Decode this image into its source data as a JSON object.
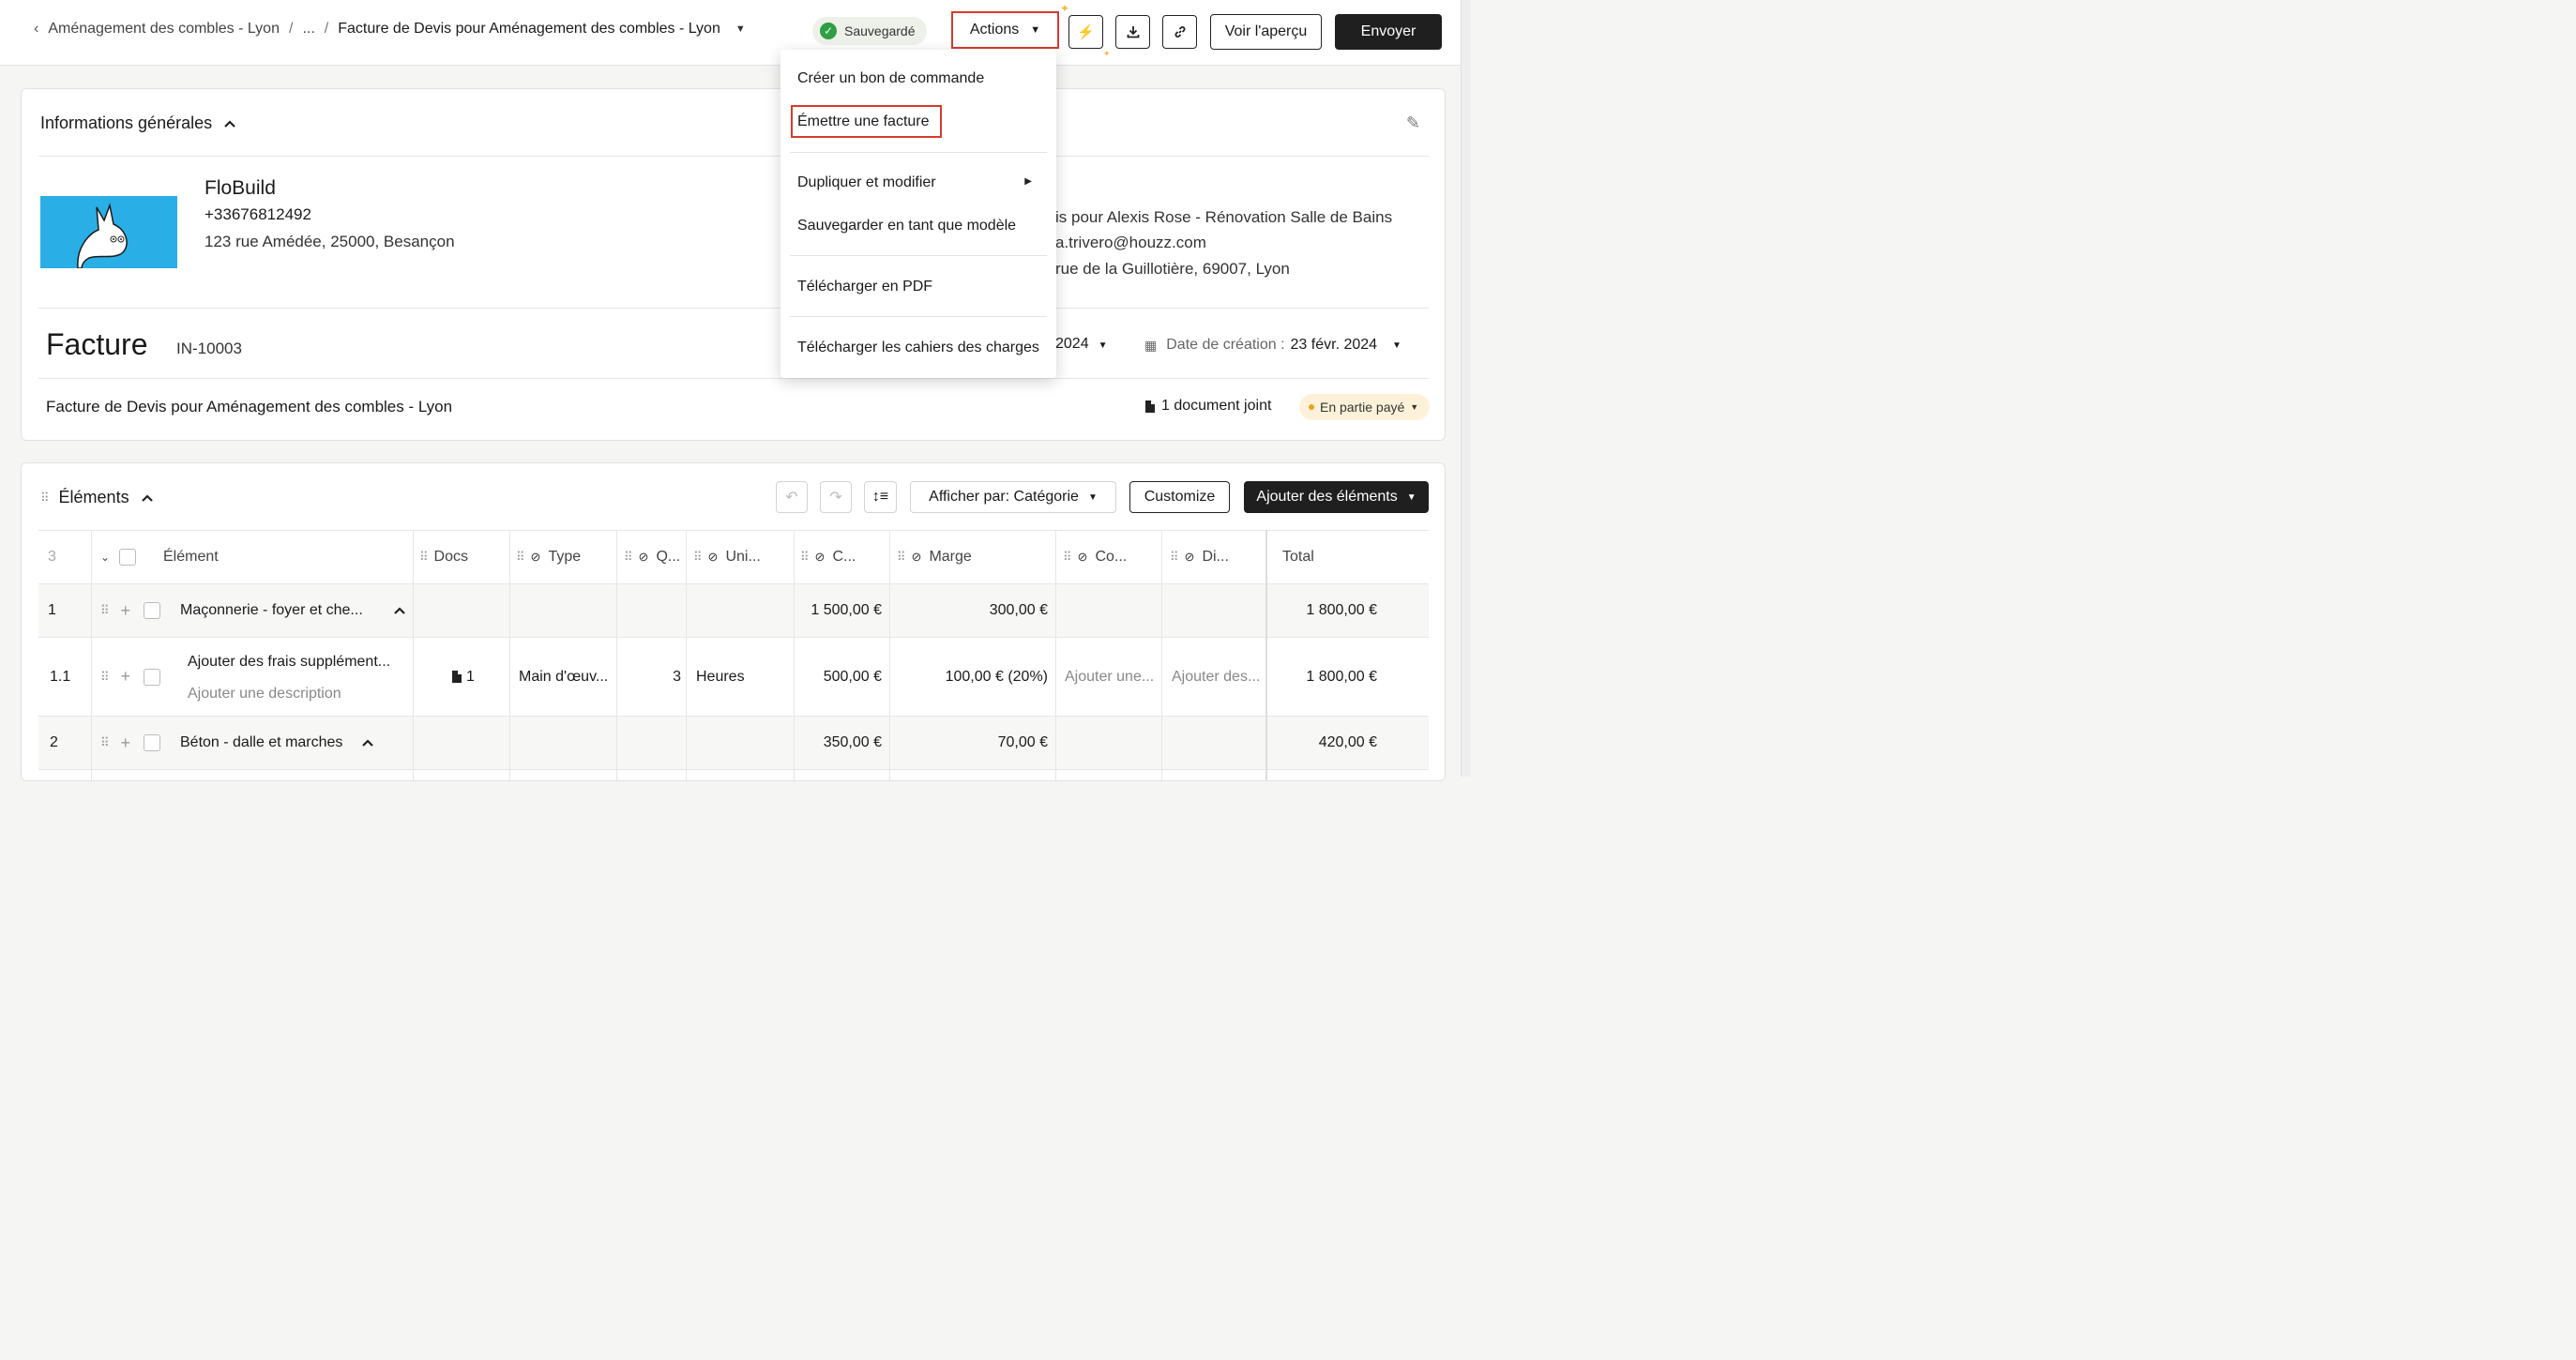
{
  "breadcrumb": {
    "parent": "Aménagement des combles - Lyon",
    "ellipsis": "...",
    "current": "Facture de Devis pour Aménagement des combles - Lyon"
  },
  "header": {
    "saved_label": "Sauvegardé",
    "actions_label": "Actions",
    "preview_label": "Voir l'aperçu",
    "send_label": "Envoyer"
  },
  "actions_menu": {
    "items": [
      "Créer un bon de commande",
      "Émettre une facture",
      "Dupliquer et modifier",
      "Sauvegarder en tant que modèle",
      "Télécharger en PDF",
      "Télécharger les cahiers des charges"
    ]
  },
  "general": {
    "title": "Informations générales",
    "company": {
      "name": "FloBuild",
      "phone": "+33676812492",
      "address": "123 rue Amédée, 25000, Besançon"
    },
    "client": {
      "line1": "is pour Alexis Rose - Rénovation Salle de Bains",
      "line2": "a.trivero@houzz.com",
      "line3": "rue de la Guillotière, 69007, Lyon"
    },
    "doc_type": "Facture",
    "doc_number": "IN-10003",
    "due_date_partial": "2024",
    "created_label": "Date de création :",
    "created_value": "23 févr. 2024",
    "description": "Facture de Devis pour Aménagement des combles - Lyon",
    "attachments": "1 document joint",
    "status": "En partie payé"
  },
  "elements": {
    "title": "Éléments",
    "view_by": "Afficher par: Catégorie",
    "customize": "Customize",
    "add_label": "Ajouter des éléments",
    "row_count": "3",
    "columns": {
      "element": "Élément",
      "docs": "Docs",
      "type": "Type",
      "qty": "Q...",
      "unit": "Uni...",
      "cost": "C...",
      "margin": "Marge",
      "co": "Co...",
      "di": "Di...",
      "total": "Total"
    },
    "rows": [
      {
        "num": "1",
        "name": "Maçonnerie - foyer et che...",
        "cost": "1 500,00 €",
        "margin": "300,00 €",
        "total": "1 800,00 €"
      },
      {
        "num": "1.1",
        "name": "Ajouter des frais supplément...",
        "desc": "Ajouter une description",
        "docs": "1",
        "type": "Main d'œuv...",
        "qty": "3",
        "unit": "Heures",
        "cost": "500,00 €",
        "margin": "100,00 € (20%)",
        "co": "Ajouter une...",
        "di": "Ajouter des...",
        "total": "1 800,00 €"
      },
      {
        "num": "2",
        "name": "Béton - dalle et marches",
        "cost": "350,00 €",
        "margin": "70,00 €",
        "total": "420,00 €"
      }
    ]
  }
}
